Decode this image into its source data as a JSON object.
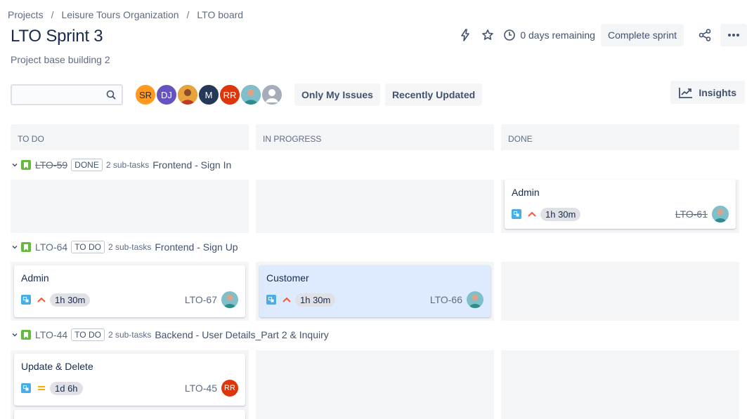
{
  "breadcrumb": [
    "Projects",
    "Leisure Tours Organization",
    "LTO board"
  ],
  "title": "LTO Sprint 3",
  "subtitle": "Project base building 2",
  "header": {
    "remaining": "0 days remaining",
    "complete_sprint": "Complete sprint"
  },
  "search": {
    "placeholder": ""
  },
  "avatars": [
    {
      "initials": "SR",
      "color": "#ff991f"
    },
    {
      "initials": "DJ",
      "color": "#6554c0"
    },
    {
      "initials": "",
      "color": "#c9866b"
    },
    {
      "initials": "M",
      "color": "#253858"
    },
    {
      "initials": "RR",
      "color": "#de350b"
    },
    {
      "initials": "",
      "color": "#5aa1b5"
    },
    {
      "initials": "",
      "color": "#a5adba"
    }
  ],
  "filters": {
    "only_my_issues": "Only My Issues",
    "recently_updated": "Recently Updated"
  },
  "insights": "Insights",
  "columns": [
    "TO DO",
    "IN PROGRESS",
    "DONE"
  ],
  "swimlanes": [
    {
      "key": "LTO-59",
      "status": "DONE",
      "subtasks": "2 sub-tasks",
      "name": "Frontend - Sign In",
      "cards": [
        {
          "title": "Admin",
          "estimate": "1h 30m",
          "key": "LTO-61"
        }
      ]
    },
    {
      "key": "LTO-64",
      "status": "TO DO",
      "subtasks": "2 sub-tasks",
      "name": "Frontend - Sign Up",
      "cards": [
        {
          "title": "Admin",
          "estimate": "1h 30m",
          "key": "LTO-67"
        },
        {
          "title": "Customer",
          "estimate": "1h 30m",
          "key": "LTO-66"
        }
      ]
    },
    {
      "key": "LTO-44",
      "status": "TO DO",
      "subtasks": "2 sub-tasks",
      "name": "Backend - User Details_Part 2 & Inquiry",
      "cards": [
        {
          "title": "Update & Delete",
          "estimate": "1d 6h",
          "key": "LTO-45",
          "assignee": "RR"
        }
      ]
    }
  ],
  "colors": {
    "story": "#63ba3c",
    "subtask": "#4bade8",
    "priority_high": "#ff5630",
    "priority_medium": "#ffab00",
    "selected_card": "#deebff"
  }
}
